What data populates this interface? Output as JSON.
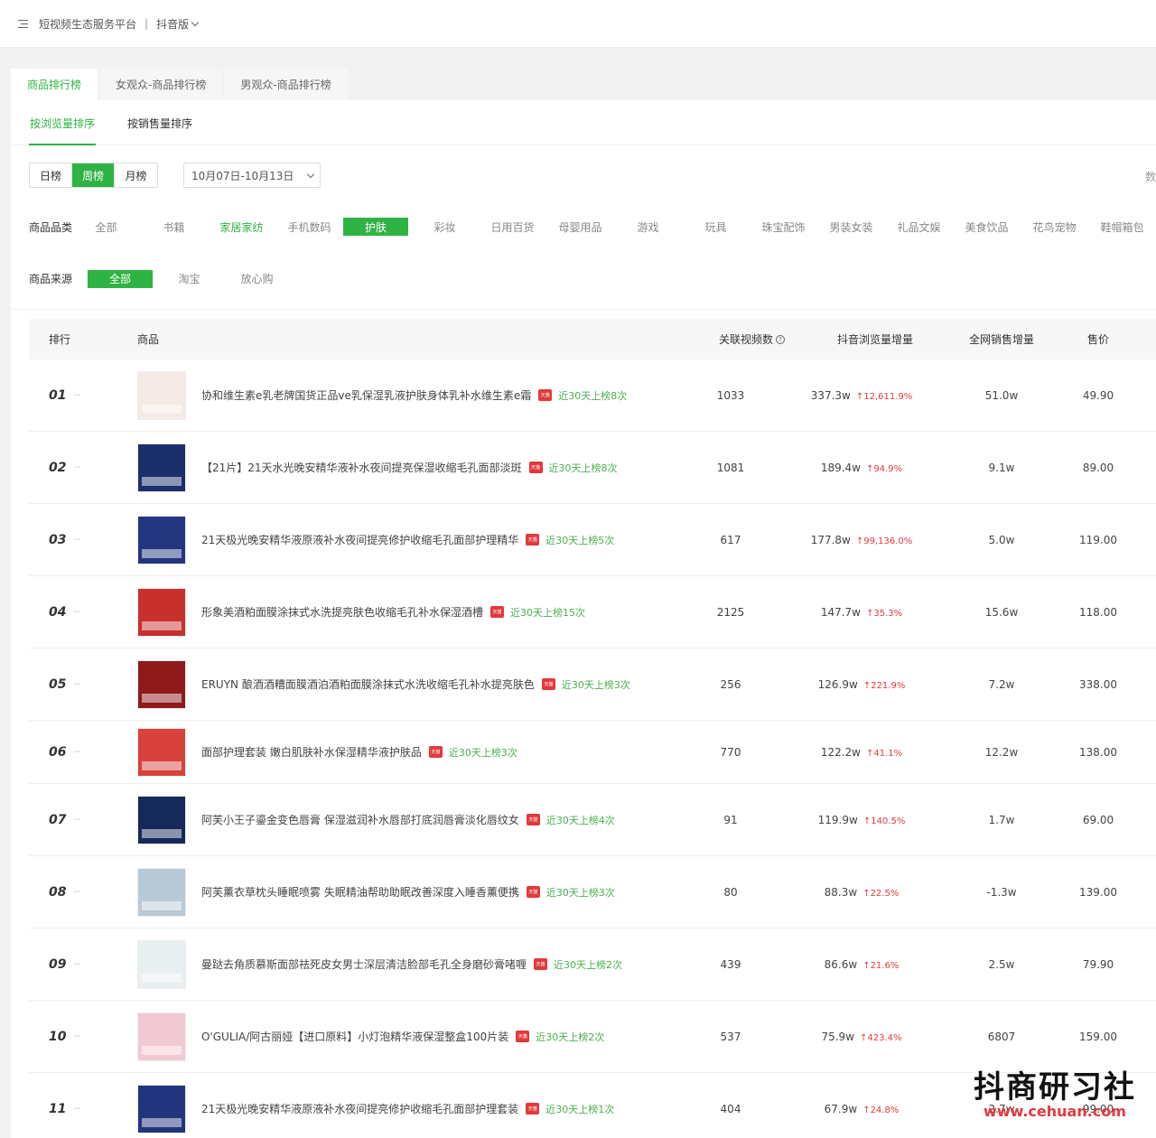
{
  "topbar": {
    "platform": "短视频生态服务平台",
    "separator": "|",
    "edition": "抖音版"
  },
  "tabs": [
    {
      "label": "商品排行榜",
      "active": true
    },
    {
      "label": "女观众-商品排行榜",
      "active": false
    },
    {
      "label": "男观众-商品排行榜",
      "active": false
    }
  ],
  "subtabs": [
    {
      "label": "按浏览量排序",
      "active": true
    },
    {
      "label": "按销售量排序",
      "active": false
    }
  ],
  "period": {
    "options": [
      "日榜",
      "周榜",
      "月榜"
    ],
    "active": "周榜",
    "date_range": "10月07日-10月13日",
    "right_cut": "数"
  },
  "category": {
    "label": "商品品类",
    "items": [
      "全部",
      "书籍",
      "家居家纺",
      "手机数码",
      "护肤",
      "彩妆",
      "日用百货",
      "母婴用品",
      "游戏",
      "玩具",
      "珠宝配饰",
      "男装女装",
      "礼品文娱",
      "美食饮品",
      "花鸟宠物",
      "鞋帽箱包"
    ],
    "active": "护肤",
    "highlight": "家居家纺"
  },
  "source": {
    "label": "商品来源",
    "items": [
      "全部",
      "淘宝",
      "放心购"
    ],
    "active": "全部"
  },
  "table": {
    "headers": {
      "rank": "排行",
      "product": "商品",
      "videos": "关联视频数",
      "views": "抖音浏览量增量",
      "sales": "全网销售增量",
      "price": "售价"
    },
    "rows": [
      {
        "rank": "01",
        "dash": "--",
        "name": "协和维生素e乳老牌国货正品ve乳保湿乳液护肤身体乳补水维生素e霜",
        "badge": "天猫",
        "hot": "近30天上榜8次",
        "videos": "1033",
        "views": "337.3w",
        "inc": "↑12,611.9%",
        "sales": "51.0w",
        "price": "49.90",
        "thumb_color": "#f4e9e4"
      },
      {
        "rank": "02",
        "dash": "--",
        "name": "【21片】21天水光晚安精华液补水夜间提亮保湿收缩毛孔面部淡斑",
        "badge": "天猫",
        "hot": "近30天上榜8次",
        "videos": "1081",
        "views": "189.4w",
        "inc": "↑94.9%",
        "sales": "9.1w",
        "price": "89.00",
        "thumb_color": "#1b2f6b"
      },
      {
        "rank": "03",
        "dash": "--",
        "name": "21天极光晚安精华液原液补水夜间提亮修护收缩毛孔面部护理精华",
        "badge": "天猫",
        "hot": "近30天上榜5次",
        "videos": "617",
        "views": "177.8w",
        "inc": "↑99,136.0%",
        "sales": "5.0w",
        "price": "119.00",
        "thumb_color": "#23357e"
      },
      {
        "rank": "04",
        "dash": "--",
        "name": "形象美酒粕面膜涂抹式水洗提亮肤色收缩毛孔补水保湿酒槽",
        "badge": "天猫",
        "hot": "近30天上榜15次",
        "videos": "2125",
        "views": "147.7w",
        "inc": "↑35.3%",
        "sales": "15.6w",
        "price": "118.00",
        "thumb_color": "#c8302e"
      },
      {
        "rank": "05",
        "dash": "--",
        "name": "ERUYN 酿酒酒糟面膜酒泊酒粕面膜涂抹式水洗收缩毛孔补水提亮肤色",
        "badge": "天猫",
        "hot": "近30天上榜3次",
        "videos": "256",
        "views": "126.9w",
        "inc": "↑221.9%",
        "sales": "7.2w",
        "price": "338.00",
        "thumb_color": "#8e1a1c"
      },
      {
        "rank": "06",
        "dash": "--",
        "name": "面部护理套装 嫩白肌肤补水保湿精华液护肤品",
        "badge": "天猫",
        "hot": "近30天上榜3次",
        "videos": "770",
        "views": "122.2w",
        "inc": "↑41.1%",
        "sales": "12.2w",
        "price": "138.00",
        "thumb_color": "#d8423c"
      },
      {
        "rank": "07",
        "dash": "--",
        "name": "阿芙小王子鎏金变色唇膏 保湿滋润补水唇部打底润唇膏淡化唇纹女",
        "badge": "天猫",
        "hot": "近30天上榜4次",
        "videos": "91",
        "views": "119.9w",
        "inc": "↑140.5%",
        "sales": "1.7w",
        "price": "69.00",
        "thumb_color": "#17295a"
      },
      {
        "rank": "08",
        "dash": "--",
        "name": "阿芙薰衣草枕头睡眠喷雾 失眠精油帮助助眠改善深度入睡香薰便携",
        "badge": "天猫",
        "hot": "近30天上榜3次",
        "videos": "80",
        "views": "88.3w",
        "inc": "↑22.5%",
        "sales": "-1.3w",
        "price": "139.00",
        "thumb_color": "#b9c9d6"
      },
      {
        "rank": "09",
        "dash": "--",
        "name": "曼跶去角质慕斯面部祛死皮女男士深层清洁脸部毛孔全身磨砂膏啫喱",
        "badge": "天猫",
        "hot": "近30天上榜2次",
        "videos": "439",
        "views": "86.6w",
        "inc": "↑21.6%",
        "sales": "2.5w",
        "price": "79.90",
        "thumb_color": "#e9eef0"
      },
      {
        "rank": "10",
        "dash": "--",
        "name": "O'GULIA/阿古丽娅【进口原料】小灯泡精华液保湿整盒100片装",
        "badge": "天猫",
        "hot": "近30天上榜2次",
        "videos": "537",
        "views": "75.9w",
        "inc": "↑423.4%",
        "sales": "6807",
        "price": "159.00",
        "thumb_color": "#f1c9d3"
      },
      {
        "rank": "11",
        "dash": "--",
        "name": "21天极光晚安精华液原液补水夜间提亮修护收缩毛孔面部护理套装",
        "badge": "天猫",
        "hot": "近30天上榜1次",
        "videos": "404",
        "views": "67.9w",
        "inc": "↑24.8%",
        "sales": "2.7w",
        "price": "99.00",
        "thumb_color": "#22357c"
      }
    ]
  },
  "watermark": {
    "title": "抖商研习社",
    "url": "www.cehuan.com"
  },
  "colors": {
    "accent": "#2fb344",
    "increase": "#e4393c",
    "tmall": "#e4393c"
  }
}
